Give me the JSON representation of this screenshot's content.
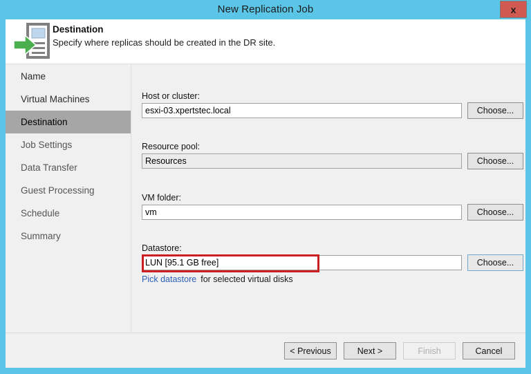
{
  "window": {
    "title": "New Replication Job",
    "close_label": "x",
    "titlebar_color": "#5bc5e8",
    "close_color": "#d05a52"
  },
  "header": {
    "icon": "replication-destination-icon",
    "title": "Destination",
    "subtitle": "Specify where replicas should be created in the DR site.",
    "icon_arrow_color": "#4caf4f",
    "icon_body_color": "#808080",
    "icon_screen_color": "#bcd7ee"
  },
  "sidebar": {
    "items": [
      {
        "label": "Name",
        "state": "done"
      },
      {
        "label": "Virtual Machines",
        "state": "done"
      },
      {
        "label": "Destination",
        "state": "active"
      },
      {
        "label": "Job Settings",
        "state": "pending"
      },
      {
        "label": "Data Transfer",
        "state": "pending"
      },
      {
        "label": "Guest Processing",
        "state": "pending"
      },
      {
        "label": "Schedule",
        "state": "pending"
      },
      {
        "label": "Summary",
        "state": "pending"
      }
    ],
    "active_color": "#a6a6a6"
  },
  "form": {
    "host": {
      "label": "Host or cluster:",
      "value": "esxi-03.xpertstec.local",
      "button": "Choose..."
    },
    "resource_pool": {
      "label": "Resource pool:",
      "value": "Resources",
      "button": "Choose..."
    },
    "vm_folder": {
      "label": "VM folder:",
      "value": "vm",
      "button": "Choose..."
    },
    "datastore": {
      "label": "Datastore:",
      "value": "LUN [95.1 GB free]",
      "button": "Choose..."
    },
    "pick_link": "Pick datastore",
    "pick_suffix": "for selected virtual disks"
  },
  "annotation": {
    "name": "datastore-highlight",
    "color": "#cc1f22"
  },
  "footer": {
    "previous": "< Previous",
    "next": "Next >",
    "finish": "Finish",
    "cancel": "Cancel"
  }
}
